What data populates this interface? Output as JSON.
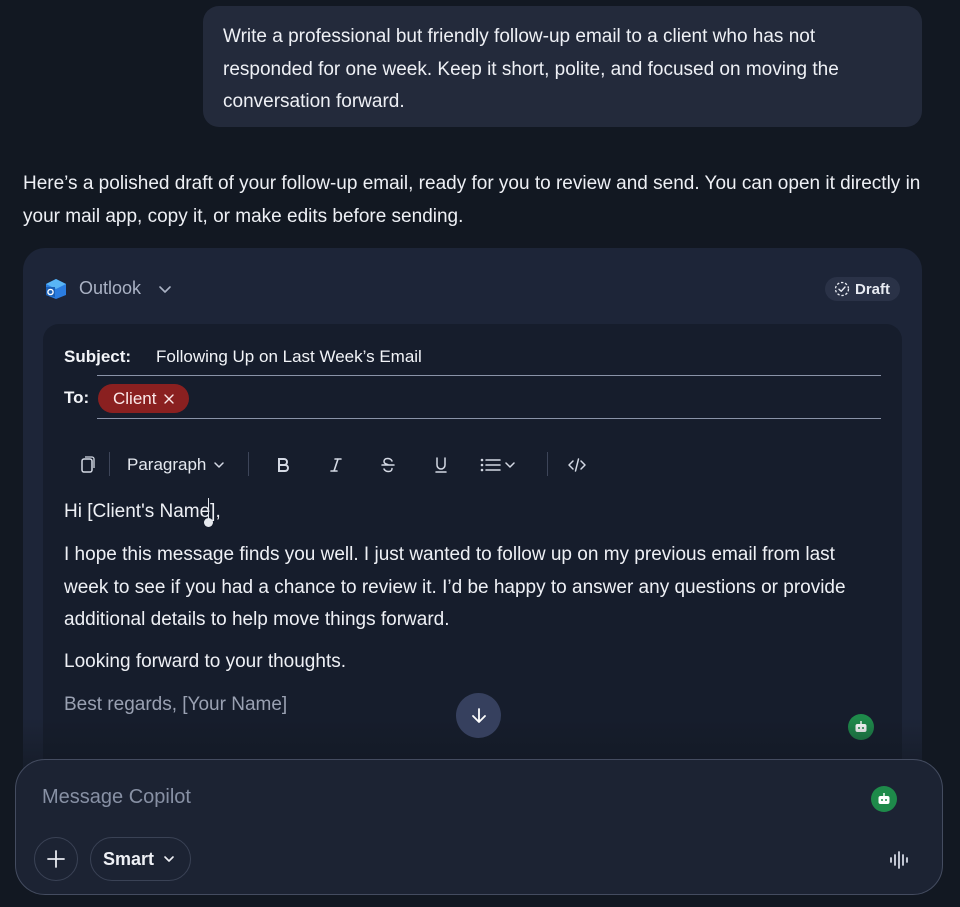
{
  "user_message": "Write a professional but friendly follow-up email to a client who has not responded for one week. Keep it short, polite, and focused on moving the conversation forward.",
  "assistant_intro": "Here’s a polished draft of your follow-up email, ready for you to review and send. You can open it directly in your mail app, copy it, or make edits before sending.",
  "email_card": {
    "app_name": "Outlook",
    "status_label": "Draft",
    "subject_label": "Subject:",
    "subject_value": "Following Up on Last Week’s Email",
    "to_label": "To:",
    "recipient_chip": "Client",
    "toolbar": {
      "paragraph_label": "Paragraph",
      "icons": [
        "copy-icon",
        "bold-icon",
        "italic-icon",
        "strikethrough-icon",
        "underline-icon",
        "list-icon",
        "code-icon"
      ]
    },
    "body": {
      "greeting": "Hi [Client's Name],",
      "main": "I hope this message finds you well. I just wanted to follow up on my previous email from last week to see if you had a chance to review it. I’d be happy to answer any questions or provide additional details to help move things forward.",
      "closing": "Looking forward to your thoughts.",
      "signature": "Best regards, [Your Name]"
    }
  },
  "composer": {
    "placeholder": "Message Copilot",
    "mode_label": "Smart"
  },
  "colors": {
    "background": "#121822",
    "card": "#1d2538",
    "chip": "#8a2020",
    "bot_badge": "#1e8a4a"
  }
}
